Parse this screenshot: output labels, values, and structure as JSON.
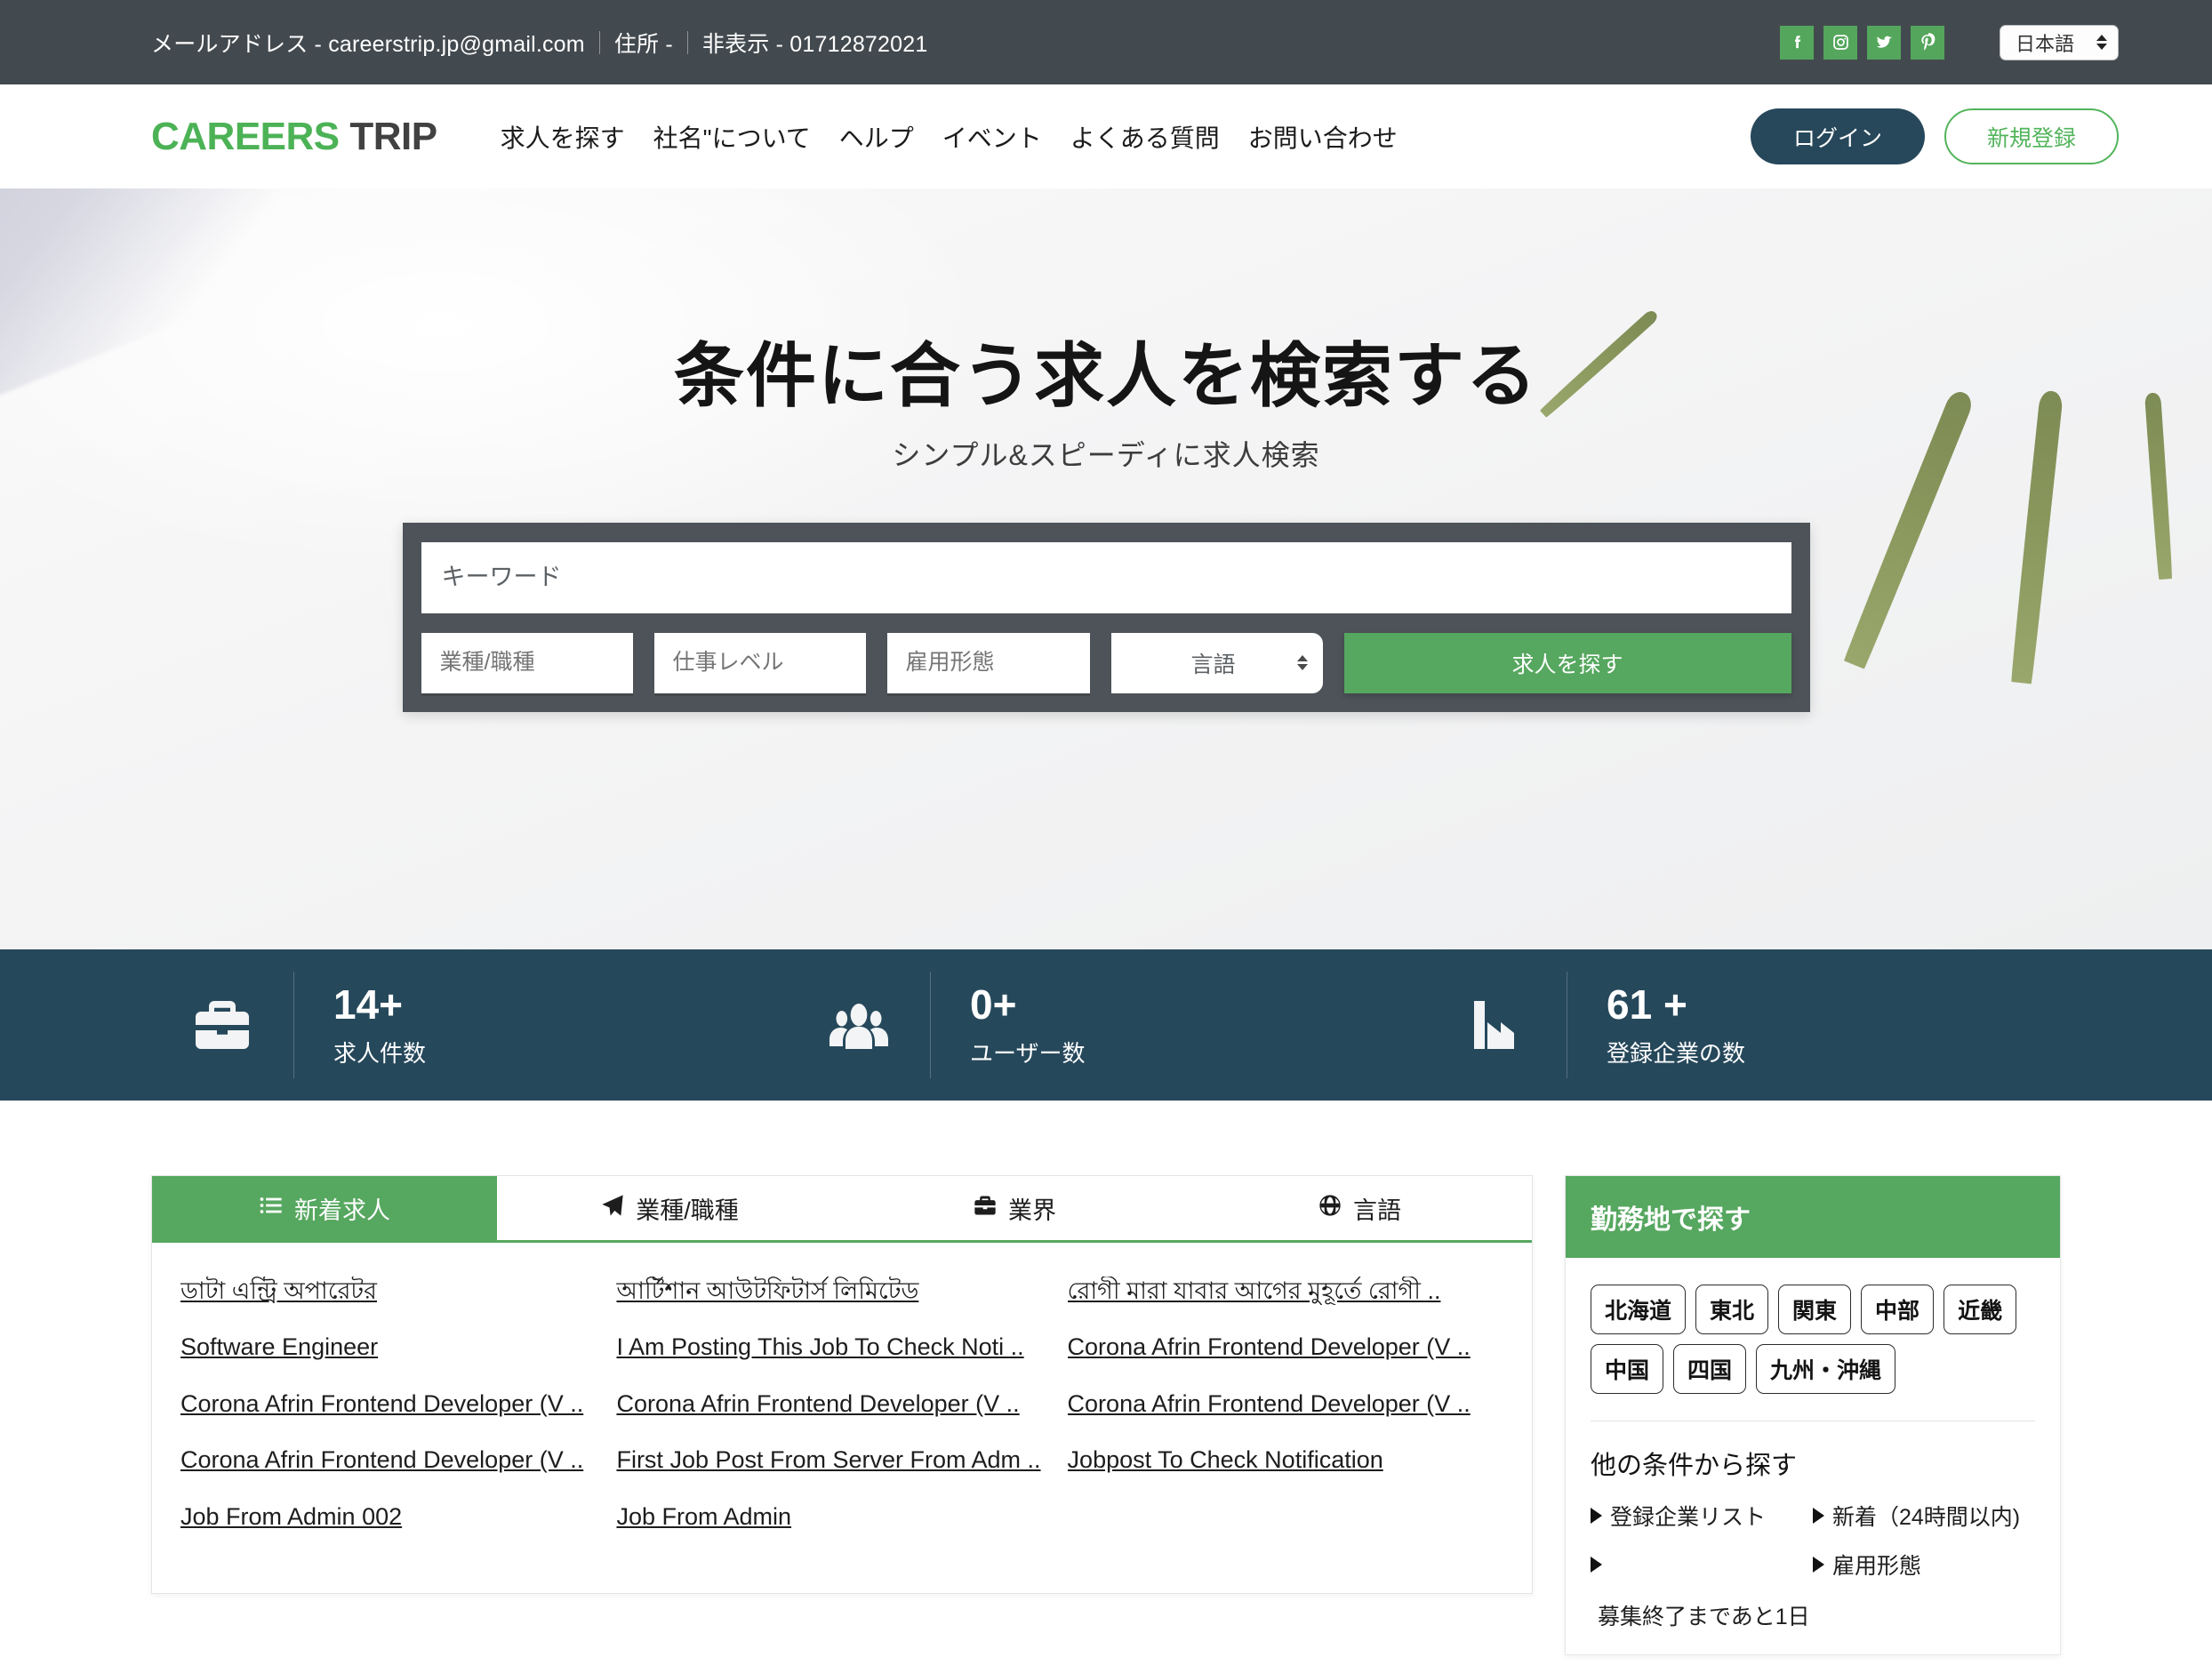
{
  "topbar": {
    "email_label": "メールアドレス - careerstrip.jp@gmail.com",
    "address_label": "住所 -",
    "phone_label": "非表示 - 01712872021",
    "social": [
      {
        "name": "facebook-icon",
        "label": "Facebook"
      },
      {
        "name": "instagram-icon",
        "label": "Instagram"
      },
      {
        "name": "twitter-icon",
        "label": "Twitter"
      },
      {
        "name": "pinterest-icon",
        "label": "Pinterest"
      }
    ],
    "language_selected": "日本語"
  },
  "header": {
    "logo_part1": "CAREERS",
    "logo_part2": "TRIP",
    "nav": [
      {
        "label": "求人を探す"
      },
      {
        "label": "社名\"について"
      },
      {
        "label": "ヘルプ"
      },
      {
        "label": "イベント"
      },
      {
        "label": "よくある質問"
      },
      {
        "label": "お問い合わせ"
      }
    ],
    "login_label": "ログイン",
    "register_label": "新規登録"
  },
  "hero": {
    "title": "条件に合う求人を検索する",
    "subtitle": "シンプル&スピーディに求人検索",
    "search": {
      "keyword_placeholder": "キーワード",
      "field_industry_placeholder": "業種/職種",
      "field_level_placeholder": "仕事レベル",
      "field_employment_placeholder": "雇用形態",
      "field_language_value": "言語",
      "submit_label": "求人を探す"
    }
  },
  "stats": [
    {
      "icon": "briefcase-icon",
      "number": "14+",
      "caption": "求人件数"
    },
    {
      "icon": "users-icon",
      "number": "0+",
      "caption": "ユーザー数"
    },
    {
      "icon": "factory-icon",
      "number": "61 +",
      "caption": "登録企業の数"
    }
  ],
  "joblist": {
    "tabs": [
      {
        "label": "新着求人",
        "icon": "list-icon",
        "active": true
      },
      {
        "label": "業種/職種",
        "icon": "paper-plane-icon",
        "active": false
      },
      {
        "label": "業界",
        "icon": "briefcase-icon",
        "active": false
      },
      {
        "label": "言語",
        "icon": "globe-icon",
        "active": false
      }
    ],
    "columns": [
      [
        "ডাটা এন্ট্রি অপারেটর",
        "Software Engineer",
        "Corona Afrin Frontend Developer (V ..",
        "Corona Afrin Frontend Developer (V ..",
        "Job From Admin 002"
      ],
      [
        "আর্টিশান আউটফিটার্স লিমিটেড",
        "I Am Posting This Job To Check Noti ..",
        "Corona Afrin Frontend Developer (V ..",
        "First Job Post From Server From Adm ..",
        "Job From Admin"
      ],
      [
        "রোগী মারা যাবার আগের মুহূর্তে রোগী ..",
        "Corona Afrin Frontend Developer (V ..",
        "Corona Afrin Frontend Developer (V ..",
        "Jobpost To Check Notification"
      ]
    ]
  },
  "sidebar": {
    "title": "勤務地で探す",
    "regions": [
      "北海道",
      "東北",
      "関東",
      "中部",
      "近畿",
      "中国",
      "四国",
      "九州・沖縄"
    ],
    "other_title": "他の条件から探す",
    "other_links": [
      "登録企業リスト",
      "新着（24時間以内)",
      "",
      "雇用形態"
    ],
    "note": "募集終了まであと1日"
  },
  "colors": {
    "brand_green": "#56a75f",
    "logo_green": "#4cb256",
    "dark_navy": "#26485b",
    "topbar_grey": "#434a4f",
    "search_panel": "#4d5358"
  }
}
